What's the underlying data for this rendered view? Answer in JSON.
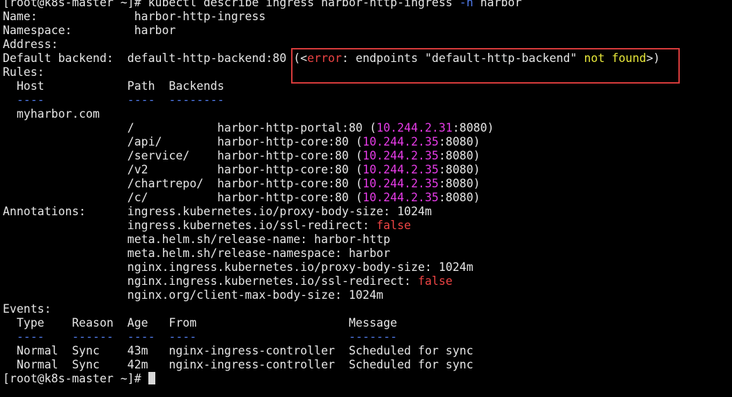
{
  "terminal": {
    "lines": [
      [
        {
          "t": "[root@k8s-master ~]# kubectl describe ingress harbor-http-ingress "
        },
        {
          "t": "-n",
          "c": "blue"
        },
        {
          "t": " harbor"
        }
      ],
      [
        {
          "t": "Name:              harbor-http-ingress"
        }
      ],
      [
        {
          "t": "Namespace:         harbor"
        }
      ],
      [
        {
          "t": "Address:"
        }
      ],
      [
        {
          "t": "Default backend:  default-http-backend:80 (<"
        },
        {
          "t": "error",
          "c": "red"
        },
        {
          "t": ": endpoints \"default-http-backend\" "
        },
        {
          "t": "not found",
          "c": "yellow"
        },
        {
          "t": ">)"
        }
      ],
      [
        {
          "t": "Rules:"
        }
      ],
      [
        {
          "t": "  Host            Path  Backends"
        }
      ],
      [
        {
          "t": "  ----            ----  --------",
          "c": "blue"
        }
      ],
      [
        {
          "t": "  myharbor.com"
        }
      ],
      [
        {
          "t": "                  /            harbor-http-portal:80 ("
        },
        {
          "t": "10.244.2.31",
          "c": "magenta"
        },
        {
          "t": ":8080)"
        }
      ],
      [
        {
          "t": "                  /api/        harbor-http-core:80 ("
        },
        {
          "t": "10.244.2.35",
          "c": "magenta"
        },
        {
          "t": ":8080)"
        }
      ],
      [
        {
          "t": "                  /service/    harbor-http-core:80 ("
        },
        {
          "t": "10.244.2.35",
          "c": "magenta"
        },
        {
          "t": ":8080)"
        }
      ],
      [
        {
          "t": "                  /v2          harbor-http-core:80 ("
        },
        {
          "t": "10.244.2.35",
          "c": "magenta"
        },
        {
          "t": ":8080)"
        }
      ],
      [
        {
          "t": "                  /chartrepo/  harbor-http-core:80 ("
        },
        {
          "t": "10.244.2.35",
          "c": "magenta"
        },
        {
          "t": ":8080)"
        }
      ],
      [
        {
          "t": "                  /c/          harbor-http-core:80 ("
        },
        {
          "t": "10.244.2.35",
          "c": "magenta"
        },
        {
          "t": ":8080)"
        }
      ],
      [
        {
          "t": "Annotations:      ingress.kubernetes.io/proxy-body-size: 1024m"
        }
      ],
      [
        {
          "t": "                  ingress.kubernetes.io/ssl-redirect: "
        },
        {
          "t": "false",
          "c": "red"
        }
      ],
      [
        {
          "t": "                  meta.helm.sh/release-name: harbor-http"
        }
      ],
      [
        {
          "t": "                  meta.helm.sh/release-namespace: harbor"
        }
      ],
      [
        {
          "t": "                  nginx.ingress.kubernetes.io/proxy-body-size: 1024m"
        }
      ],
      [
        {
          "t": "                  nginx.ingress.kubernetes.io/ssl-redirect: "
        },
        {
          "t": "false",
          "c": "red"
        }
      ],
      [
        {
          "t": "                  nginx.org/client-max-body-size: 1024m"
        }
      ],
      [
        {
          "t": "Events:"
        }
      ],
      [
        {
          "t": "  Type    Reason  Age   From                      Message"
        }
      ],
      [
        {
          "t": "  ----    ------  ----  ----                      -------",
          "c": "blue"
        }
      ],
      [
        {
          "t": "  Normal  Sync    43m   nginx-ingress-controller  Scheduled for sync"
        }
      ],
      [
        {
          "t": "  Normal  Sync    42m   nginx-ingress-controller  Scheduled for sync"
        }
      ],
      [
        {
          "t": "[root@k8s-master ~]# "
        }
      ]
    ]
  },
  "colors": {
    "background": "#000000",
    "default": "#e6e6e6",
    "blue": "#4f79e8",
    "magenta": "#e53be6",
    "red": "#ee4444",
    "yellow": "#e8e83a",
    "highlight_box": "#d93c3c"
  }
}
